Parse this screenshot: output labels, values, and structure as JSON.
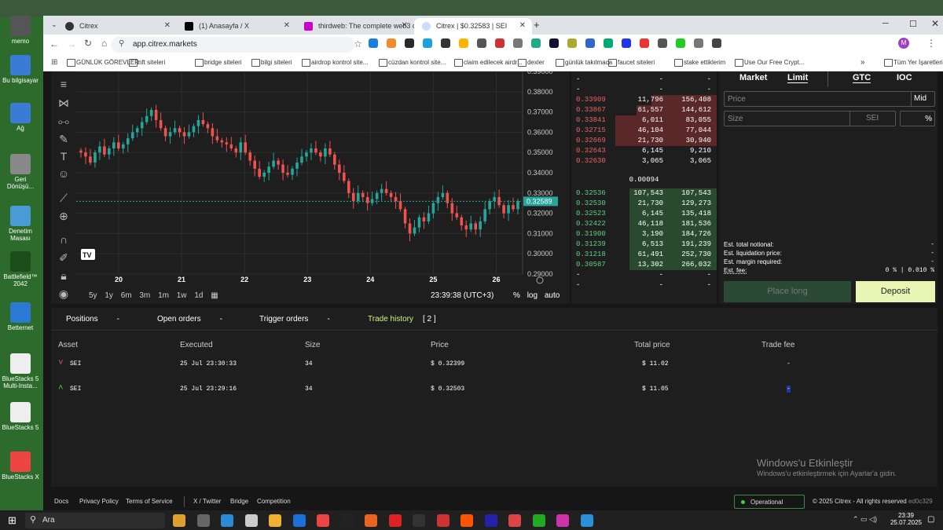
{
  "desktop": {
    "icons": [
      {
        "label": "memo",
        "color": "#555"
      },
      {
        "label": "Bu bilgisayar",
        "color": "#3a7bd5"
      },
      {
        "label": "Ağ",
        "color": "#3a7bd5"
      },
      {
        "label": "Geri Dönüşü...",
        "color": "#888"
      },
      {
        "label": "Denetim Masası",
        "color": "#4a9ad5"
      },
      {
        "label": "Battlefield™ 2042",
        "color": "#1a4d1a"
      },
      {
        "label": "Betternet",
        "color": "#2a7ad5"
      },
      {
        "label": "BlueStacks 5 Multi-Insta...",
        "color": "#eee"
      },
      {
        "label": "BlueStacks 5",
        "color": "#eee"
      },
      {
        "label": "BlueStacks X",
        "color": "#e44"
      }
    ]
  },
  "browser": {
    "tabs": [
      {
        "title": "Citrex",
        "color": "#333"
      },
      {
        "title": "(1) Anasayfa / X",
        "color": "#000"
      },
      {
        "title": "thirdweb: The complete web3 d",
        "color": "#c0c"
      },
      {
        "title": "Citrex | $0.32583 | SEI",
        "color": "#cdf",
        "active": true
      }
    ],
    "new_tab": "+",
    "url": "app.citrex.markets",
    "bookmarks": [
      "GÜNLÜK GÖREVLER",
      "nft siteleri",
      "bridge siteleri",
      "bilgi siteleri",
      "airdrop kontrol site...",
      "cüzdan kontrol site...",
      "claim edilecek airdr...",
      "dexler",
      "günlük takılmaca",
      "faucet siteleri",
      "stake ettiklerim",
      "Use Our Free Crypt..."
    ],
    "bookmarks_more": "»",
    "all_bookmarks": "Tüm Yer İşaretleri",
    "profile": "M"
  },
  "chart": {
    "price_axis": [
      "0.39000",
      "0.38000",
      "0.37000",
      "0.36000",
      "0.35000",
      "0.34000",
      "0.33000",
      "0.32000",
      "0.31000",
      "0.30000",
      "0.29000"
    ],
    "current_price": "0.32589",
    "date_axis": [
      "20",
      "21",
      "22",
      "23",
      "24",
      "25",
      "26"
    ],
    "periods": [
      "5y",
      "1y",
      "6m",
      "3m",
      "1m",
      "1w",
      "1d"
    ],
    "clock": "23:39:38 (UTC+3)",
    "scale_opts": [
      "%",
      "log",
      "auto"
    ],
    "tv_logo": "TV"
  },
  "chart_data": {
    "type": "candlestick",
    "ylim": [
      0.29,
      0.39
    ],
    "x_ticks": [
      "20",
      "21",
      "22",
      "23",
      "24",
      "25",
      "26"
    ],
    "current": 0.32589,
    "close": [
      0.35,
      0.348,
      0.345,
      0.35,
      0.353,
      0.349,
      0.352,
      0.355,
      0.352,
      0.354,
      0.357,
      0.36,
      0.362,
      0.365,
      0.368,
      0.371,
      0.366,
      0.362,
      0.358,
      0.36,
      0.362,
      0.36,
      0.358,
      0.36,
      0.363,
      0.366,
      0.364,
      0.362,
      0.358,
      0.356,
      0.355,
      0.354,
      0.352,
      0.35,
      0.355,
      0.35,
      0.346,
      0.342,
      0.338,
      0.34,
      0.343,
      0.346,
      0.344,
      0.34,
      0.339,
      0.342,
      0.345,
      0.348,
      0.35,
      0.352,
      0.35,
      0.348,
      0.352,
      0.349,
      0.344,
      0.34,
      0.336,
      0.33,
      0.326,
      0.33,
      0.328,
      0.325,
      0.327,
      0.33,
      0.332,
      0.33,
      0.328,
      0.326,
      0.322,
      0.315,
      0.31,
      0.313,
      0.318,
      0.316,
      0.32,
      0.325,
      0.328,
      0.33,
      0.325,
      0.32,
      0.318,
      0.314,
      0.312,
      0.315,
      0.312,
      0.316,
      0.322,
      0.326,
      0.328,
      0.324,
      0.32,
      0.324,
      0.322,
      0.326
    ],
    "high_pad": 0.0025,
    "low_pad": 0.0025
  },
  "orderbook": {
    "spread": "0.00094",
    "asks": [
      {
        "p": "-",
        "s": "-",
        "t": "-"
      },
      {
        "p": "-",
        "s": "-",
        "t": "-"
      },
      {
        "p": "0.33909",
        "s": "11,796",
        "t": "156,408",
        "fill": 0.45
      },
      {
        "p": "0.33867",
        "s": "61,557",
        "t": "144,612",
        "fill": 0.55
      },
      {
        "p": "0.33841",
        "s": "6,011",
        "t": "83,055",
        "fill": 0.7
      },
      {
        "p": "0.32715",
        "s": "46,104",
        "t": "77,044",
        "fill": 0.7
      },
      {
        "p": "0.32669",
        "s": "21,730",
        "t": "30,940",
        "fill": 0.7
      },
      {
        "p": "0.32643",
        "s": "6,145",
        "t": "9,210",
        "fill": 0
      },
      {
        "p": "0.32630",
        "s": "3,065",
        "t": "3,065",
        "fill": 0
      }
    ],
    "bids": [
      {
        "p": "0.32536",
        "s": "107,543",
        "t": "107,543",
        "fill": 0.6
      },
      {
        "p": "0.32530",
        "s": "21,730",
        "t": "129,273",
        "fill": 0.6
      },
      {
        "p": "0.32523",
        "s": "6,145",
        "t": "135,418",
        "fill": 0.6
      },
      {
        "p": "0.32422",
        "s": "46,118",
        "t": "181,536",
        "fill": 0.6
      },
      {
        "p": "0.31900",
        "s": "3,190",
        "t": "184,726",
        "fill": 0.6
      },
      {
        "p": "0.31239",
        "s": "6,513",
        "t": "191,239",
        "fill": 0.6
      },
      {
        "p": "0.31218",
        "s": "61,491",
        "t": "252,730",
        "fill": 0.6
      },
      {
        "p": "0.30587",
        "s": "13,302",
        "t": "266,032",
        "fill": 0.6
      },
      {
        "p": "-",
        "s": "-",
        "t": "-"
      },
      {
        "p": "-",
        "s": "-",
        "t": "-"
      }
    ]
  },
  "trade": {
    "types": [
      "Market",
      "Limit"
    ],
    "tifs": [
      "GTC",
      "IOC"
    ],
    "price_ph": "Price",
    "mid": "Mid",
    "size_ph": "Size",
    "size_unit": "SEI",
    "pct": "%",
    "rows": [
      {
        "label": "Est. total notional:",
        "value": "-"
      },
      {
        "label": "Est. liquidation price:",
        "value": "-"
      },
      {
        "label": "Est. margin required:",
        "value": "-"
      },
      {
        "label": "Est. fee:",
        "value": "0 % | 0.010 %"
      }
    ],
    "place": "Place long",
    "deposit": "Deposit"
  },
  "bottom": {
    "tabs": [
      {
        "label": "Positions",
        "count": "-"
      },
      {
        "label": "Open orders",
        "count": "-"
      },
      {
        "label": "Trigger orders",
        "count": "-"
      },
      {
        "label": "Trade history",
        "count": "[ 2 ]"
      }
    ],
    "headers": [
      "Asset",
      "Executed",
      "Size",
      "Price",
      "Total price",
      "Trade fee"
    ],
    "rows": [
      {
        "arrow": "˅",
        "asset": "SEI",
        "executed": "25 Jul 23:30:33",
        "size": "34",
        "price": "$ 0.32399",
        "total": "$ 11.02",
        "fee": "-",
        "color": "#e55"
      },
      {
        "arrow": "˄",
        "asset": "SEI",
        "executed": "25 Jul 23:29:16",
        "size": "34",
        "price": "$ 0.32503",
        "total": "$ 11.05",
        "fee": "-",
        "color": "#5c5"
      }
    ],
    "watermark_title": "Windows'u Etkinleştir",
    "watermark_sub": "Windows'u etkinleştirmek için Ayarlar'a gidin."
  },
  "footer": {
    "links": [
      "Docs",
      "Privacy Policy",
      "Terms of Service",
      "X / Twitter",
      "Bridge",
      "Competition"
    ],
    "status": "Operational",
    "copyright": "© 2025 Citrex - All rights reserved",
    "build": "ed0c329"
  },
  "taskbar": {
    "search": "Ara",
    "time": "23:39",
    "date": "25.07.2025"
  }
}
